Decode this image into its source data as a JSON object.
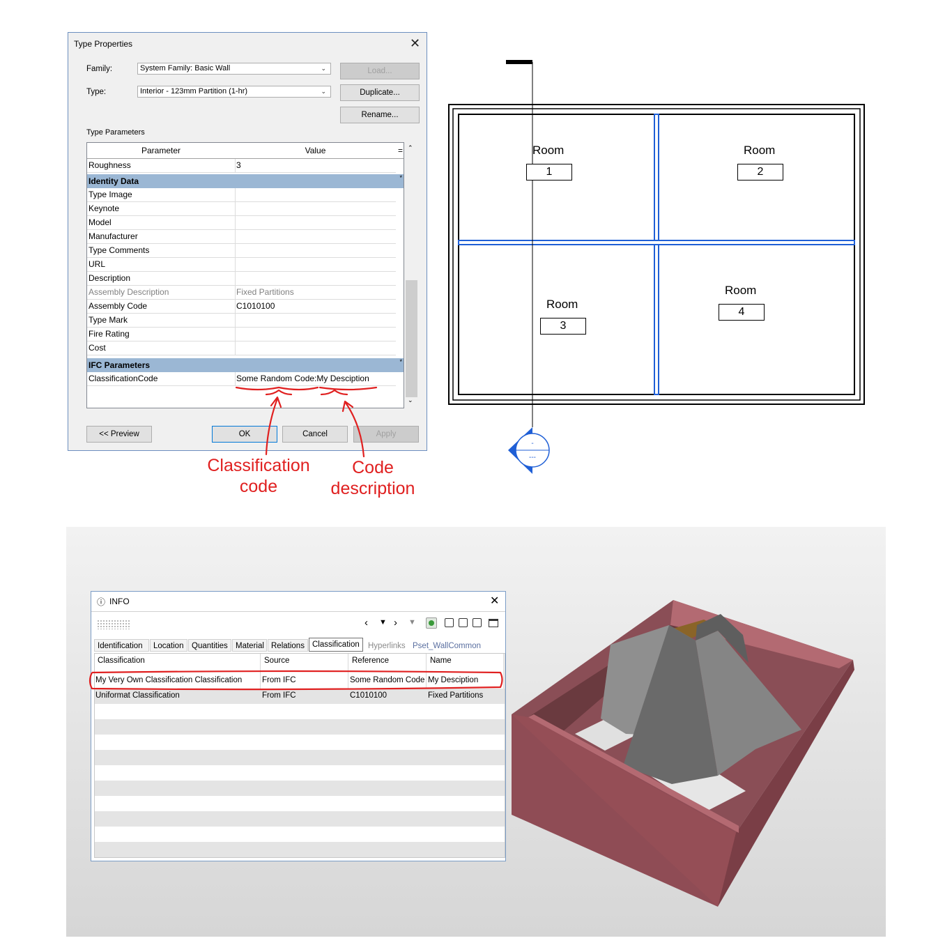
{
  "type_properties": {
    "title": "Type Properties",
    "family_label": "Family:",
    "family_value": "System Family: Basic Wall",
    "type_label": "Type:",
    "type_value": "Interior - 123mm Partition (1-hr)",
    "buttons": {
      "load": "Load...",
      "duplicate": "Duplicate...",
      "rename": "Rename..."
    },
    "section_label": "Type Parameters",
    "col_parameter": "Parameter",
    "col_value": "Value",
    "col_eq": "=",
    "rows_top": [
      {
        "param": "Roughness",
        "value": "3"
      }
    ],
    "group_identity": "Identity Data",
    "identity_rows": [
      {
        "param": "Type Image",
        "value": ""
      },
      {
        "param": "Keynote",
        "value": ""
      },
      {
        "param": "Model",
        "value": ""
      },
      {
        "param": "Manufacturer",
        "value": ""
      },
      {
        "param": "Type Comments",
        "value": ""
      },
      {
        "param": "URL",
        "value": ""
      },
      {
        "param": "Description",
        "value": ""
      },
      {
        "param": "Assembly Description",
        "value": "Fixed Partitions"
      },
      {
        "param": "Assembly Code",
        "value": "C1010100"
      },
      {
        "param": "Type Mark",
        "value": ""
      },
      {
        "param": "Fire Rating",
        "value": ""
      },
      {
        "param": "Cost",
        "value": ""
      }
    ],
    "group_ifc": "IFC Parameters",
    "ifc_rows": [
      {
        "param": "ClassificationCode",
        "value": "Some Random Code:My Desciption"
      }
    ],
    "footer": {
      "preview": "<< Preview",
      "ok": "OK",
      "cancel": "Cancel",
      "apply": "Apply"
    }
  },
  "annotations": {
    "classification_code": [
      "Classification",
      "code"
    ],
    "code_description": [
      "Code",
      "description"
    ],
    "color": "#e02020"
  },
  "floor_plan": {
    "rooms": [
      {
        "label": "Room",
        "number": "1"
      },
      {
        "label": "Room",
        "number": "2"
      },
      {
        "label": "Room",
        "number": "3"
      },
      {
        "label": "Room",
        "number": "4"
      }
    ],
    "section_marker": {
      "top": "-",
      "bottom": "---"
    },
    "wall_highlight_color": "#1f5fd6"
  },
  "info_panel": {
    "title": "INFO",
    "tabs": [
      "Identification",
      "Location",
      "Quantities",
      "Material",
      "Relations",
      "Classification",
      "Hyperlinks",
      "Pset_WallCommon"
    ],
    "active_tab": "Classification",
    "columns": [
      "Classification",
      "Source",
      "Reference",
      "Name"
    ],
    "rows": [
      [
        "My Very Own Classification Classification",
        "From IFC",
        "Some Random Code",
        "My Desciption"
      ],
      [
        "Uniformat Classification",
        "From IFC",
        "C1010100",
        "Fixed Partitions"
      ]
    ]
  },
  "model_view": {
    "wall_color": "#a0525a",
    "partition_color": "#7a7a7a"
  }
}
